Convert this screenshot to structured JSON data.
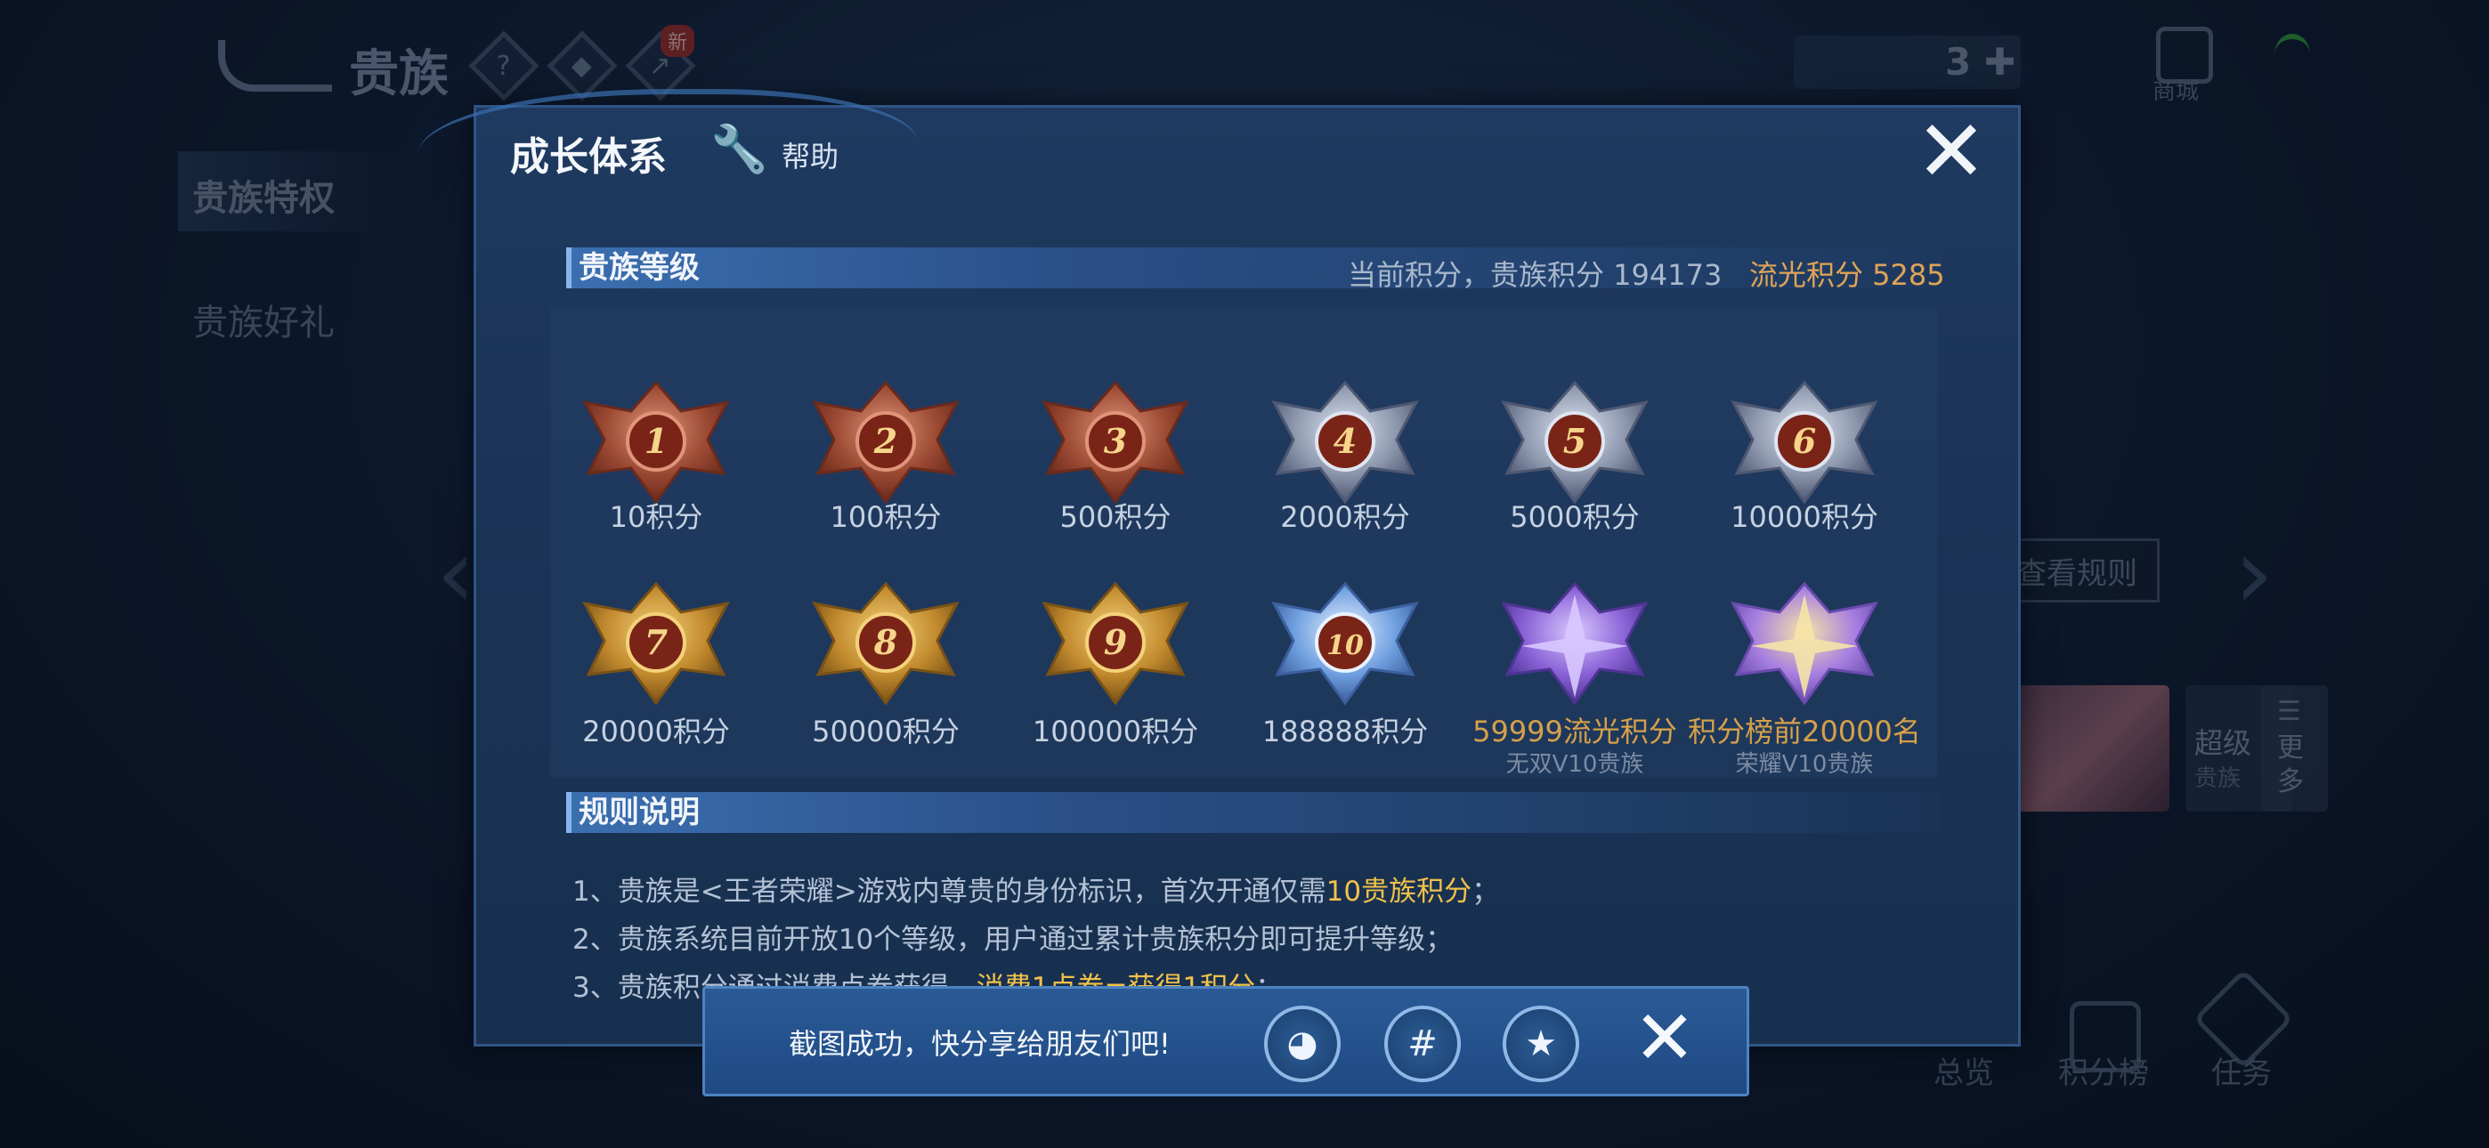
{
  "background": {
    "title": "贵族",
    "new_badge": "新",
    "ticket_count": "3",
    "shop_label": "商城",
    "side_tab_1": "贵族特权",
    "side_tab_2": "贵族好礼",
    "view_rules": "查看规则",
    "super_label": "超级",
    "super_sub": "贵族",
    "more_label": "更多",
    "bottom_nav": [
      "总览",
      "积分榜",
      "任务"
    ]
  },
  "dialog": {
    "title": "成长体系",
    "help_label": "帮助",
    "level_section_title": "贵族等级",
    "current_score_label": "当前积分，贵族积分 194173",
    "liuguang_label": "流光积分 5285",
    "rules_section_title": "规则说明"
  },
  "levels": [
    {
      "num": "1",
      "label": "10积分",
      "tier": "bronze"
    },
    {
      "num": "2",
      "label": "100积分",
      "tier": "bronze"
    },
    {
      "num": "3",
      "label": "500积分",
      "tier": "bronze"
    },
    {
      "num": "4",
      "label": "2000积分",
      "tier": "silver"
    },
    {
      "num": "5",
      "label": "5000积分",
      "tier": "silver"
    },
    {
      "num": "6",
      "label": "10000积分",
      "tier": "silver"
    },
    {
      "num": "7",
      "label": "20000积分",
      "tier": "gold"
    },
    {
      "num": "8",
      "label": "50000积分",
      "tier": "gold"
    },
    {
      "num": "9",
      "label": "100000积分",
      "tier": "gold"
    },
    {
      "num": "10",
      "label": "188888积分",
      "tier": "platinum"
    },
    {
      "num": "",
      "label": "59999流光积分",
      "sub": "无双V10贵族",
      "tier": "purple"
    },
    {
      "num": "",
      "label": "积分榜前20000名",
      "sub": "荣耀V10贵族",
      "tier": "purple-gold"
    }
  ],
  "rules": {
    "r1_a": "1、贵族是<王者荣耀>游戏内尊贵的身份标识，首次开通仅需",
    "r1_hl": "10贵族积分",
    "r1_b": "；",
    "r2": "2、贵族系统目前开放10个等级，用户通过累计贵族积分即可提升等级；",
    "r3_a": "3、贵族积分通过消费点券获得，",
    "r3_hl": "消费1点券=获得1积分",
    "r3_b": "；"
  },
  "toast": {
    "text": "截图成功，快分享给朋友们吧!",
    "icons": [
      "qq-icon",
      "hashtag-icon",
      "qzone-icon"
    ]
  },
  "colors": {
    "highlight": "#f1c24a",
    "liuguang": "#e0a456",
    "bronze": "#c0704e",
    "silver": "#a7b3c9",
    "gold": "#d9a441",
    "purple": "#8f6ad8"
  }
}
